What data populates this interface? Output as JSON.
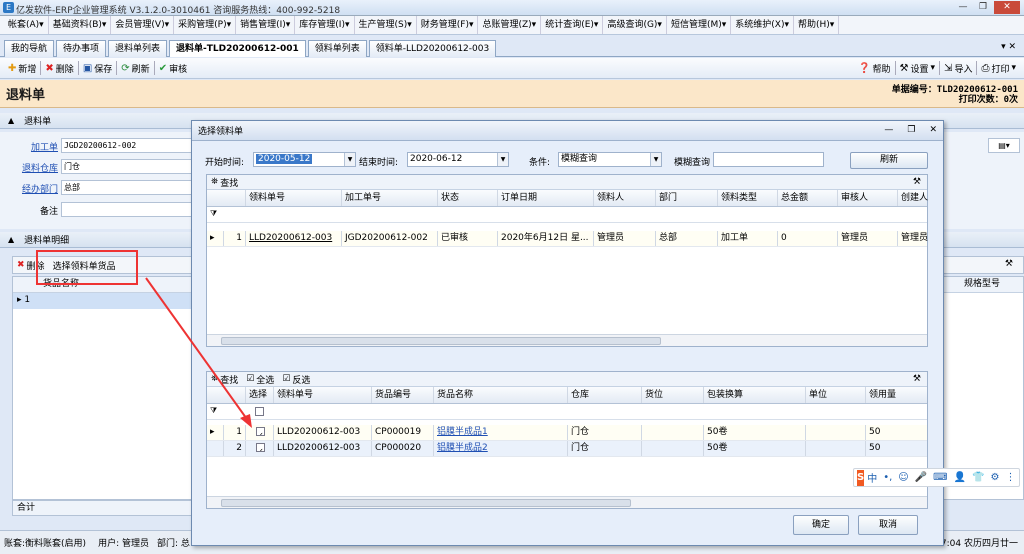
{
  "window": {
    "title": "亿发软件-ERP企业管理系统 V3.1.2.0-3010461 咨询服务热线：400-992-5218",
    "icon_label": "E"
  },
  "menu": [
    "帐套(A)▾",
    "基础资料(B)▾",
    "会员管理(V)▾",
    "采购管理(P)▾",
    "销售管理(I)▾",
    "库存管理(I)▾",
    "生产管理(S)▾",
    "财务管理(F)▾",
    "总账管理(Z)▾",
    "统计查询(E)▾",
    "高级查询(G)▾",
    "短信管理(M)▾",
    "系统维护(X)▾",
    "帮助(H)▾"
  ],
  "tabs": [
    "我的导航",
    "待办事项",
    "退料单列表",
    "退料单-TLD20200612-001",
    "领料单列表",
    "领料单-LLD20200612-003"
  ],
  "toolbar": {
    "new": "新增",
    "delete": "删除",
    "save": "保存",
    "refresh": "刷新",
    "audit": "审核",
    "help": "帮助",
    "settings": "设置",
    "import": "导入",
    "print": "打印"
  },
  "header": {
    "title": "退料单",
    "doc_no": "单据编号：TLD20200612-001",
    "print_count": "打印次数：0次"
  },
  "form": {
    "section": "退料单",
    "fields": [
      {
        "label": "加工单",
        "value": "JGD20200612-002"
      },
      {
        "label": "退料仓库",
        "value": "门仓"
      },
      {
        "label": "经办部门",
        "value": "总部"
      },
      {
        "label": "备注",
        "value": ""
      }
    ]
  },
  "detail": {
    "section": "退料单明细",
    "delete": "删除",
    "select_goods": "选择领料单货品",
    "col_name": "货品名称",
    "row_no": "1",
    "col_spec": "规格型号",
    "sum": "合计"
  },
  "status": {
    "account": "账套:衡料账套(启用)",
    "user": "用户: 管理员",
    "dept": "部门: 总",
    "time": "7:04 农历四月廿一"
  },
  "dialog": {
    "title": "选择领料单",
    "start_label": "开始时间:",
    "start": "2020-05-12",
    "end_label": "结束时间:",
    "end": "2020-06-12",
    "cond_label": "条件:",
    "cond": "模糊查询",
    "fuzzy_label": "模糊查询",
    "refresh": "刷新",
    "find": "查找",
    "select_all": "全选",
    "invert": "反选",
    "top_cols": [
      "领料单号",
      "加工单号",
      "状态",
      "订单日期",
      "领料人",
      "部门",
      "领料类型",
      "总金额",
      "审核人",
      "创建人"
    ],
    "top_rows": [
      {
        "no": "1",
        "code": "LLD20200612-003",
        "job": "JGD20200612-002",
        "status": "已审核",
        "date": "2020年6月12日 星...",
        "picker": "管理员",
        "dept": "总部",
        "type": "加工单",
        "amount": "0",
        "auditor": "管理员",
        "creator": "管理员"
      }
    ],
    "bottom_cols": [
      "选择",
      "领料单号",
      "货品编号",
      "货品名称",
      "仓库",
      "货位",
      "包装换算",
      "单位",
      "领用量"
    ],
    "bottom_rows": [
      {
        "no": "1",
        "checked": "✓",
        "code": "LLD20200612-003",
        "item": "CP000019",
        "name": "铝膜半成品1",
        "wh": "门仓",
        "loc": "",
        "pack": "50卷",
        "unit": "",
        "qty": "50"
      },
      {
        "no": "2",
        "checked": "✓",
        "code": "LLD20200612-003",
        "item": "CP000020",
        "name": "铝膜半成品2",
        "wh": "门仓",
        "loc": "",
        "pack": "50卷",
        "unit": "",
        "qty": "50"
      }
    ],
    "ok": "确定",
    "cancel": "取消"
  },
  "ime": {
    "logo": "S",
    "items": [
      "中",
      "•,",
      "☺",
      "🎤",
      "⌨",
      "👤",
      "👕",
      "⚙",
      "⋮"
    ]
  }
}
